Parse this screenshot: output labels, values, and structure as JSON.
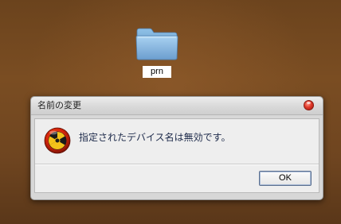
{
  "desktop": {
    "folder": {
      "icon": "folder-icon",
      "label": "prn"
    }
  },
  "dialog": {
    "title": "名前の変更",
    "close_icon": "close-icon",
    "alert_icon": "radiation-warning-icon",
    "message": "指定されたデバイス名は無効です。",
    "ok_label": "OK"
  },
  "colors": {
    "desktop_brown": "#6f4520",
    "dialog_bg": "#d7d7d7",
    "panel_bg": "#eeeeee",
    "message_text": "#1d2a4a",
    "close_red": "#e0392a",
    "folder_blue": "#7fb1dc"
  }
}
